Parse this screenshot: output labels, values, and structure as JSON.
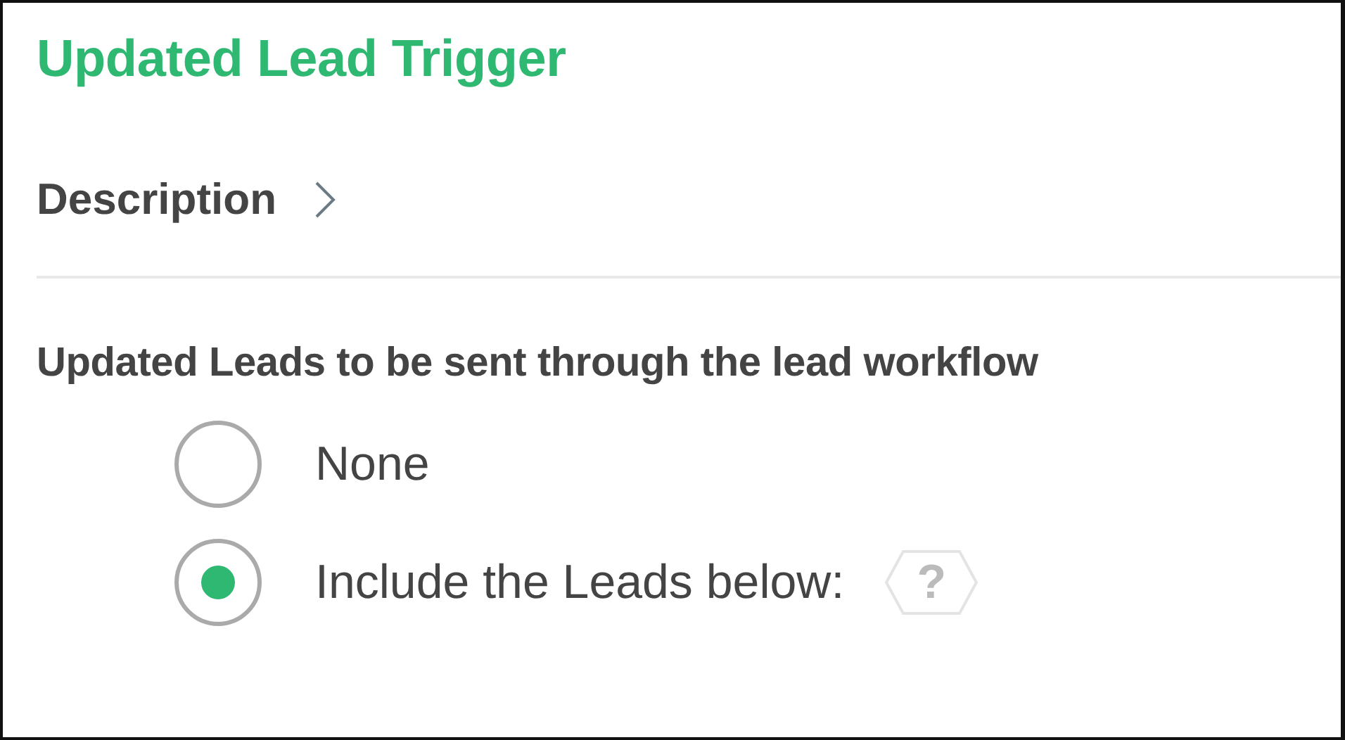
{
  "title": "Updated Lead Trigger",
  "description": {
    "label": "Description",
    "expanded": false
  },
  "section": {
    "heading": "Updated Leads to be sent through the lead workflow",
    "options": [
      {
        "label": "None",
        "selected": false
      },
      {
        "label": "Include the Leads below:",
        "selected": true,
        "help": "?"
      }
    ]
  }
}
